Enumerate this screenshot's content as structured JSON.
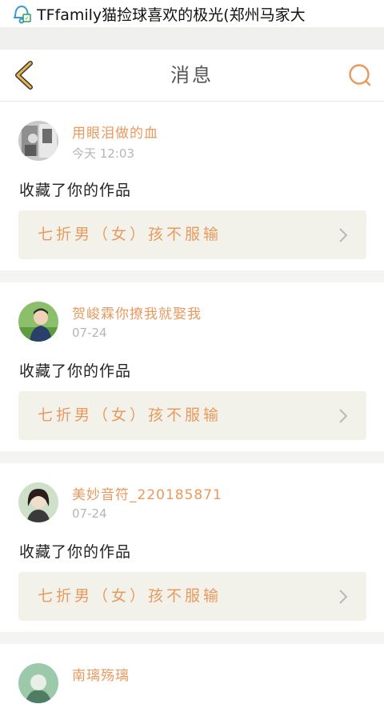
{
  "statusbar": {
    "notification_text": "TFfamily猫捡球喜欢的极光(郑州马家大"
  },
  "navbar": {
    "title": "消息"
  },
  "colors": {
    "accent": "#e89a5e",
    "back_icon": "#e6b44a",
    "work_box_bg": "#f3f2ea"
  },
  "messages": [
    {
      "username": "用眼泪做的血",
      "time": "今天 12:03",
      "action": "收藏了你的作品",
      "work_title": "七折男（女）孩不服输"
    },
    {
      "username": "贺峻霖你撩我就娶我",
      "time": "07-24",
      "action": "收藏了你的作品",
      "work_title": "七折男（女）孩不服输"
    },
    {
      "username": "美妙音符_220185871",
      "time": "07-24",
      "action": "收藏了你的作品",
      "work_title": "七折男（女）孩不服输"
    },
    {
      "username": "南璃殇璃"
    }
  ]
}
